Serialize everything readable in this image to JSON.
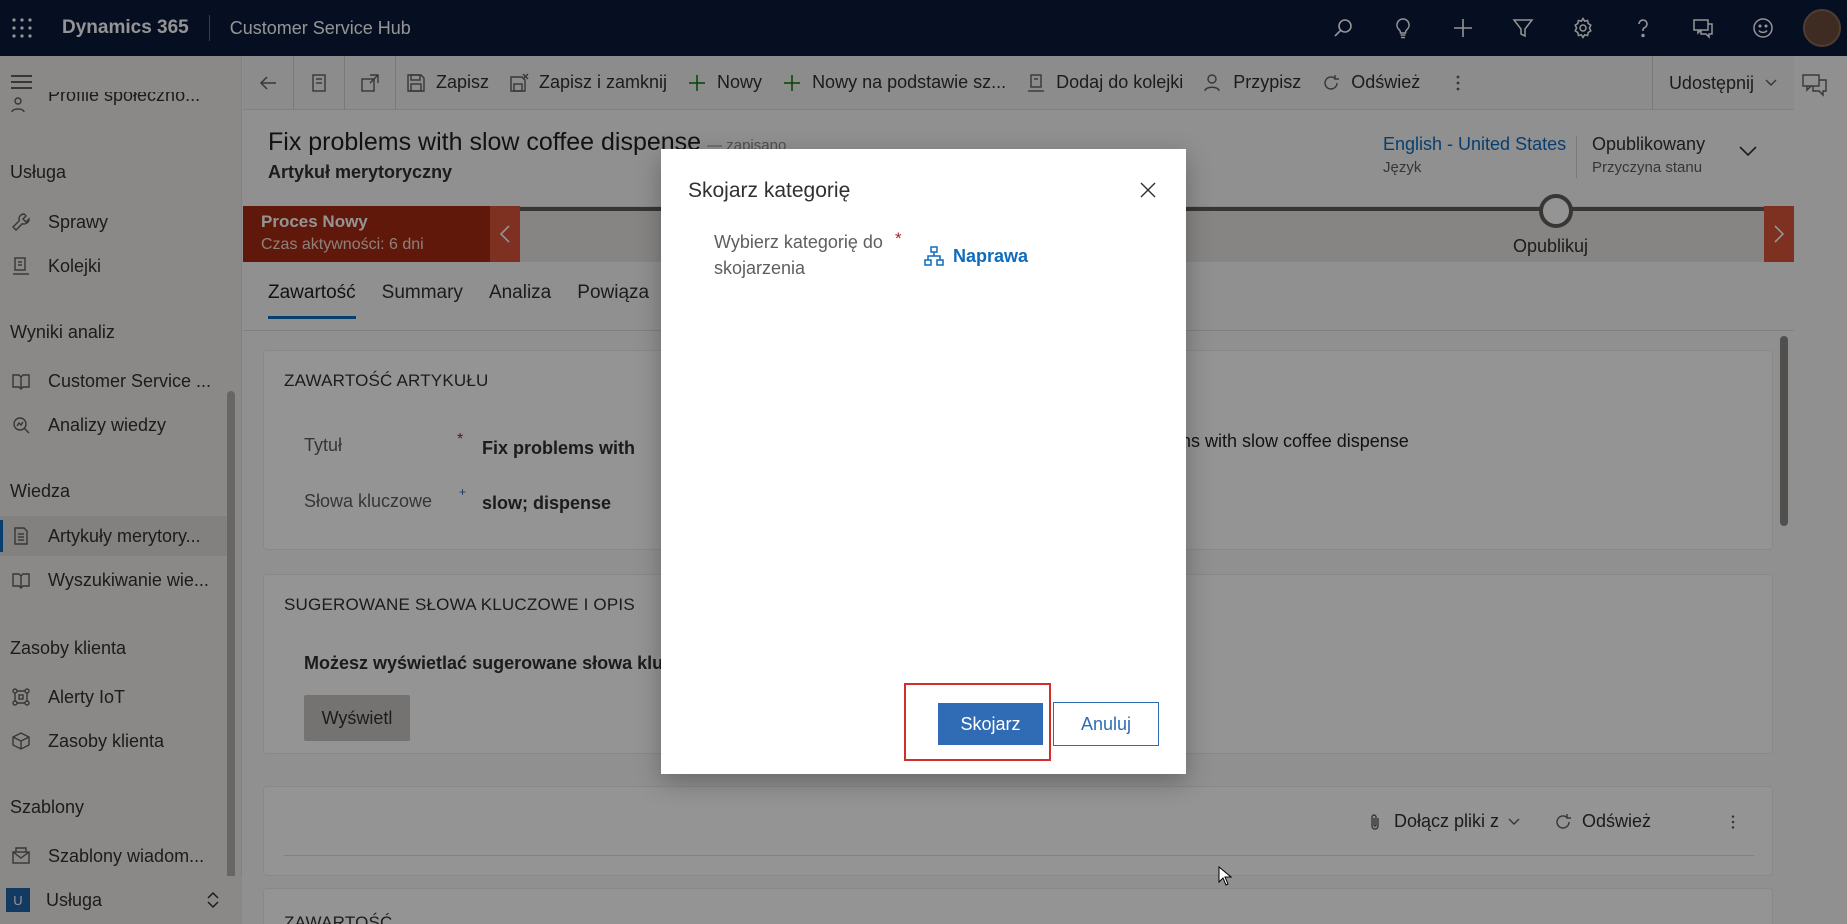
{
  "topbar": {
    "brand": "Dynamics 365",
    "app_name": "Customer Service Hub"
  },
  "sidebar": {
    "partial_item": "Profile społeczno...",
    "groups": [
      {
        "heading": "Usługa",
        "items": [
          {
            "label": "Sprawy"
          },
          {
            "label": "Kolejki"
          }
        ]
      },
      {
        "heading": "Wyniki analiz",
        "items": [
          {
            "label": "Customer Service ..."
          },
          {
            "label": "Analizy wiedzy"
          }
        ]
      },
      {
        "heading": "Wiedza",
        "items": [
          {
            "label": "Artykuły merytory..."
          },
          {
            "label": "Wyszukiwanie wie..."
          }
        ]
      },
      {
        "heading": "Zasoby klienta",
        "items": [
          {
            "label": "Alerty IoT"
          },
          {
            "label": "Zasoby klienta"
          }
        ]
      },
      {
        "heading": "Szablony",
        "items": [
          {
            "label": "Szablony wiadom..."
          }
        ]
      }
    ],
    "area": {
      "badge": "U",
      "label": "Usługa"
    }
  },
  "commandbar": {
    "save": "Zapisz",
    "save_close": "Zapisz i zamknij",
    "new": "Nowy",
    "new_based_on": "Nowy na podstawie sz...",
    "add_to_queue": "Dodaj do kolejki",
    "assign": "Przypisz",
    "refresh": "Odśwież",
    "share": "Udostępnij"
  },
  "record": {
    "title": "Fix problems with slow coffee dispense",
    "saved_status": "— zapisano",
    "entity": "Artykuł merytoryczny",
    "language_value": "English - United States",
    "language_label": "Język",
    "status_value": "Opublikowany",
    "status_label": "Przyczyna stanu"
  },
  "bpf": {
    "stage_name": "Proces Nowy",
    "stage_time": "Czas aktywności: 6 dni",
    "node_label": "Opublikuj"
  },
  "tabs": [
    "Zawartość",
    "Summary",
    "Analiza",
    "Powiąza"
  ],
  "section_content": {
    "title": "ZAWARTOŚĆ ARTYKUŁU",
    "title_label": "Tytuł",
    "title_value": "Fix problems with",
    "title_preview": "Fix problems with slow coffee dispense",
    "keywords_label": "Słowa kluczowe",
    "keywords_value": "slow; dispense"
  },
  "section_suggest": {
    "title": "SUGEROWANE SŁOWA KLUCZOWE I OPIS",
    "text": "Możesz wyświetlać sugerowane słowa kluczo",
    "button": "Wyświetl"
  },
  "section_attach": {
    "attach": "Dołącz pliki z",
    "refresh": "Odśwież"
  },
  "section_bottom": {
    "title": "ZAWARTOŚĆ"
  },
  "dialog": {
    "title": "Skojarz kategorię",
    "field_label": "Wybierz kategorię do skojarzenia",
    "field_value": "Naprawa",
    "primary": "Skojarz",
    "secondary": "Anuluj"
  },
  "colors": {
    "nav_bg": "#0b1b3a",
    "accent": "#0f6cbd",
    "stage_bg": "#a42a12",
    "primary_btn": "#2f6cb5",
    "highlight": "#d12e2e"
  }
}
